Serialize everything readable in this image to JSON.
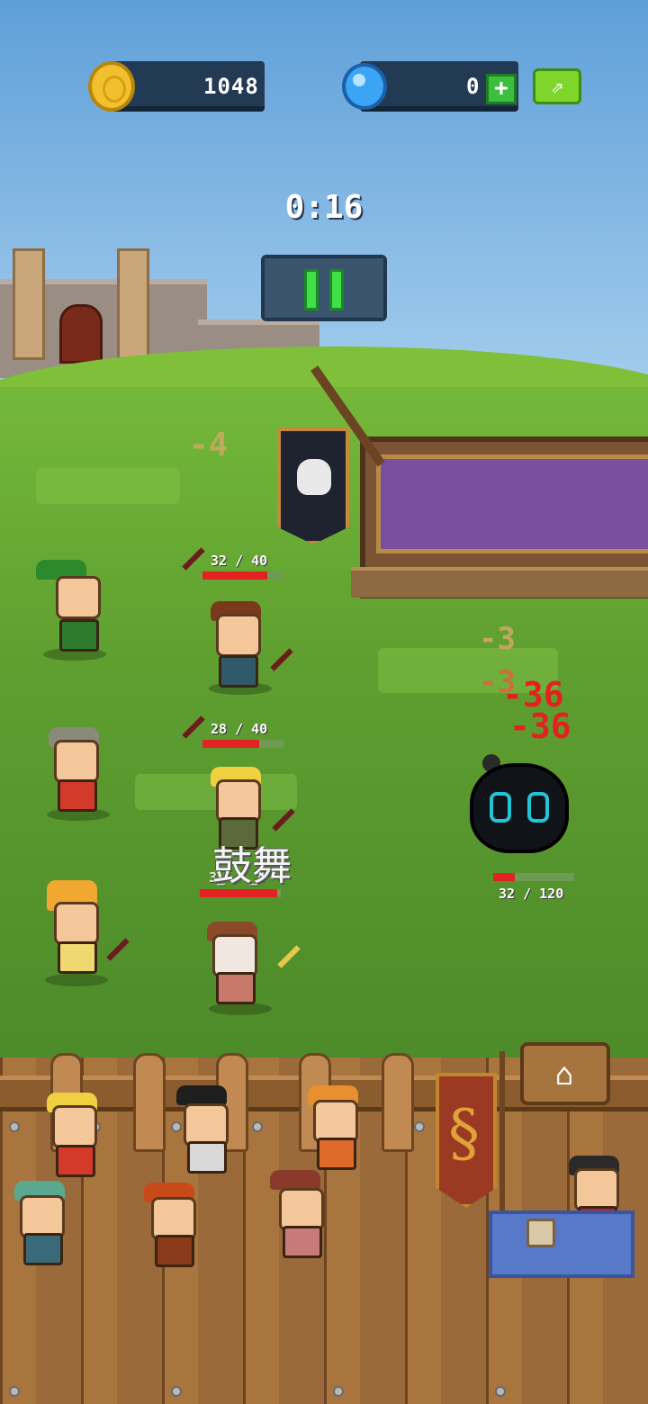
{
  "hud": {
    "coins": "1048",
    "gems": "0",
    "gem_add_label": "+",
    "share_icon": "share-icon"
  },
  "timer": "0:16",
  "pause_icon": "pause-icon",
  "heroes": [
    {
      "name": "",
      "hp": "32 / 40",
      "hp_fraction": 0.8
    },
    {
      "name": "",
      "hp": "28 / 40",
      "hp_fraction": 0.7
    },
    {
      "name": "",
      "hp": "3_ / _0",
      "hp_fraction": 0.95
    }
  ],
  "enemy": {
    "hp": "32 / 120",
    "hp_fraction": 0.27
  },
  "damage_numbers": [
    "-4",
    "-3",
    "-3",
    "-36",
    "-36"
  ],
  "buff_text": "鼓舞",
  "colors": {
    "hud_bar": "#233a55",
    "coin": "#f2c02f",
    "gem": "#3ba4f4",
    "pause": "#3fe04a",
    "hp_fill": "#e32222",
    "damage_faded": "#d9a66a",
    "damage_critical": "#e62020"
  },
  "icons": [
    "coin-icon",
    "gem-icon",
    "add-icon",
    "share-icon",
    "pause-icon",
    "home-icon"
  ]
}
